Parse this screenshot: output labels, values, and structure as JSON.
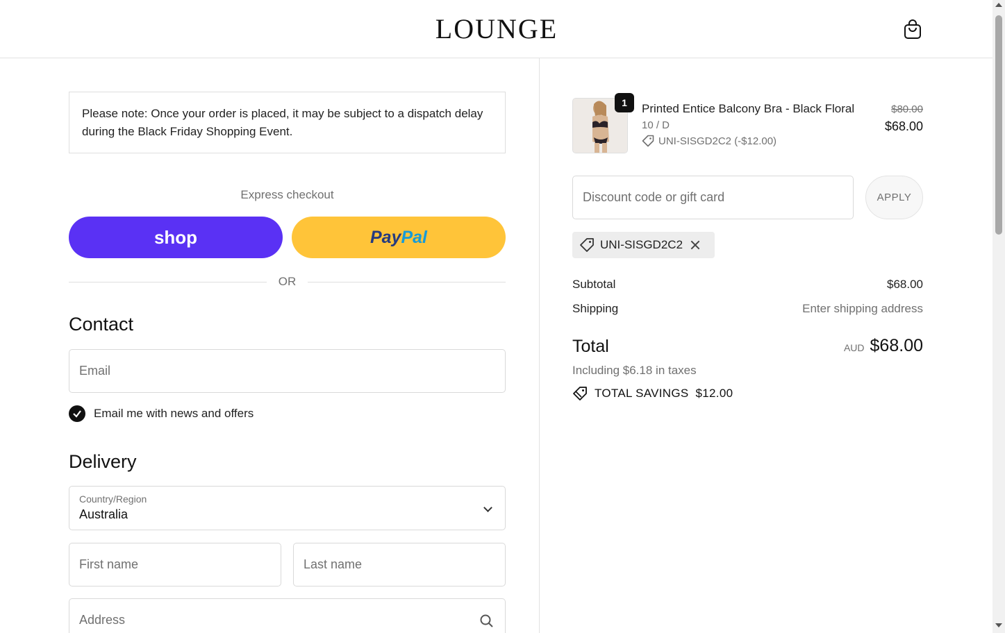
{
  "header": {
    "logo": "LOUNGE",
    "cart_icon": "shopping-bag-icon"
  },
  "notice": {
    "text": "Please note: Once your order is placed, it may be subject to a dispatch delay during the Black Friday Shopping Event."
  },
  "express": {
    "label": "Express checkout",
    "shop_label": "shop",
    "paypal_a": "Pay",
    "paypal_b": "Pal",
    "or_label": "OR"
  },
  "contact": {
    "title": "Contact",
    "email_placeholder": "Email",
    "newsletter_label": "Email me with news and offers",
    "newsletter_checked": true
  },
  "delivery": {
    "title": "Delivery",
    "country_label": "Country/Region",
    "country_value": "Australia",
    "first_name_placeholder": "First name",
    "last_name_placeholder": "Last name",
    "address_placeholder": "Address"
  },
  "order": {
    "item": {
      "quantity": "1",
      "name": "Printed Entice Balcony Bra - Black Floral",
      "variant": "10 / D",
      "discount_line": "UNI-SISGD2C2 (-$12.00)",
      "original_price": "$80.00",
      "price": "$68.00"
    },
    "discount_placeholder": "Discount code or gift card",
    "apply_label": "APPLY",
    "applied_code": "UNI-SISGD2C2",
    "subtotal_label": "Subtotal",
    "subtotal_value": "$68.00",
    "shipping_label": "Shipping",
    "shipping_value": "Enter shipping address",
    "total_label": "Total",
    "currency": "AUD",
    "total_value": "$68.00",
    "taxes_text": "Including $6.18 in taxes",
    "savings_label": "TOTAL SAVINGS",
    "savings_value": "$12.00"
  },
  "colors": {
    "shop_pay": "#5a31f4",
    "paypal": "#ffc439",
    "paypal_dark": "#253b80",
    "paypal_light": "#179bd7"
  }
}
